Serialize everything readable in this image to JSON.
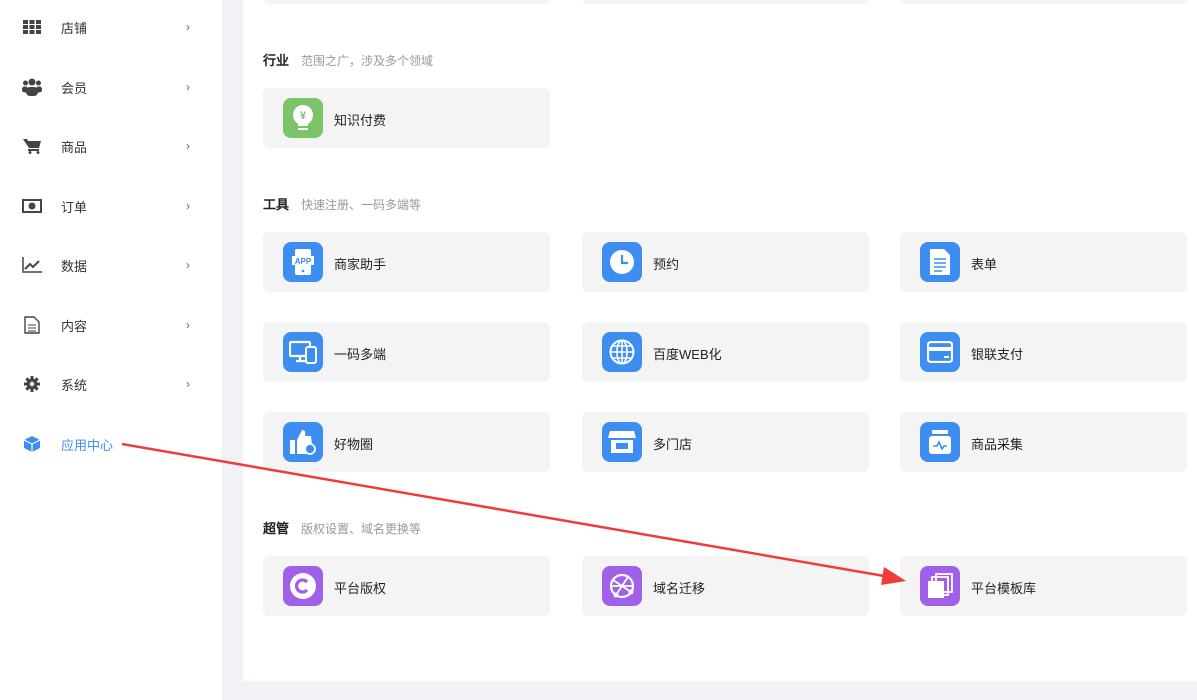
{
  "sidebar": {
    "items": [
      {
        "label": "店铺",
        "icon": "grid-icon"
      },
      {
        "label": "会员",
        "icon": "users-icon"
      },
      {
        "label": "商品",
        "icon": "cart-icon"
      },
      {
        "label": "订单",
        "icon": "money-icon"
      },
      {
        "label": "数据",
        "icon": "chart-line-icon"
      },
      {
        "label": "内容",
        "icon": "document-icon"
      },
      {
        "label": "系统",
        "icon": "gear-icon"
      },
      {
        "label": "应用中心",
        "icon": "cube-icon",
        "active": true
      }
    ],
    "chevron": "›"
  },
  "sections": [
    {
      "title": "行业",
      "desc": "范围之广，涉及多个领域",
      "apps": [
        {
          "name": "知识付费",
          "icon": "bulb-yen-icon",
          "color": "#7cc46a"
        }
      ]
    },
    {
      "title": "工具",
      "desc": "快速注册、一码多端等",
      "apps": [
        {
          "name": "商家助手",
          "icon": "app-phone-icon",
          "color": "#3d8ef0"
        },
        {
          "name": "预约",
          "icon": "clock-icon",
          "color": "#3d8ef0"
        },
        {
          "name": "表单",
          "icon": "form-icon",
          "color": "#3d8ef0"
        },
        {
          "name": "一码多端",
          "icon": "devices-icon",
          "color": "#3d8ef0"
        },
        {
          "name": "百度WEB化",
          "icon": "globe-icon",
          "color": "#3d8ef0"
        },
        {
          "name": "银联支付",
          "icon": "card-icon",
          "color": "#3d8ef0"
        },
        {
          "name": "好物圈",
          "icon": "thumbs-up-icon",
          "color": "#3d8ef0"
        },
        {
          "name": "多门店",
          "icon": "store-icon",
          "color": "#3d8ef0"
        },
        {
          "name": "商品采集",
          "icon": "collect-icon",
          "color": "#3d8ef0"
        }
      ]
    },
    {
      "title": "超管",
      "desc": "版权设置、域名更换等",
      "apps": [
        {
          "name": "平台版权",
          "icon": "copyright-icon",
          "color": "#a160e8"
        },
        {
          "name": "域名迁移",
          "icon": "domain-icon",
          "color": "#a160e8"
        },
        {
          "name": "平台模板库",
          "icon": "templates-icon",
          "color": "#a160e8"
        }
      ]
    }
  ],
  "annotation_color": "#f23a3a"
}
